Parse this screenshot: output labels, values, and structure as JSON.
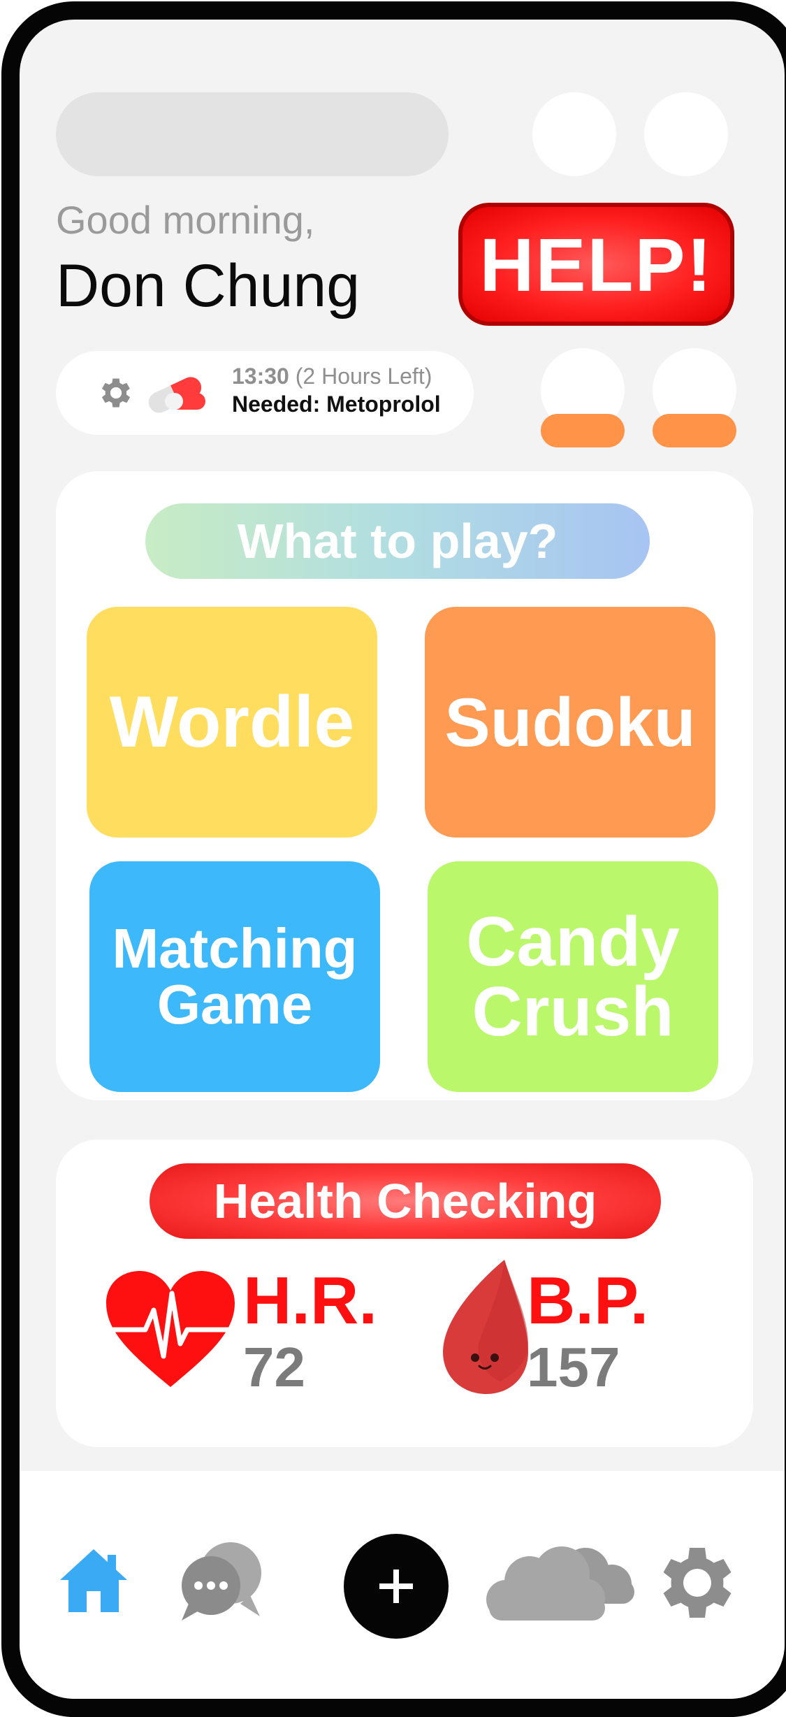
{
  "greeting": {
    "salutation": "Good morning,",
    "name": "Don Chung"
  },
  "help_button": {
    "label": "HELP!"
  },
  "medication": {
    "time": "13:30",
    "time_left": "(2 Hours Left)",
    "needed_label": "Needed:",
    "medicine": "Metoprolol",
    "icons": [
      "gear-icon",
      "pill-icon"
    ]
  },
  "games": {
    "title": "What to play?",
    "tiles": [
      {
        "label_line1": "Wordle",
        "label_line2": "",
        "color": "#ffdd5e"
      },
      {
        "label_line1": "Sudoku",
        "label_line2": "",
        "color": "#ff9a52"
      },
      {
        "label_line1": "Matching",
        "label_line2": "Game",
        "color": "#3db8fa"
      },
      {
        "label_line1": "Candy",
        "label_line2": "Crush",
        "color": "#bbf76a"
      }
    ]
  },
  "health": {
    "title": "Health Checking",
    "metrics": [
      {
        "label": "H.R.",
        "value": "72",
        "icon": "heart-icon"
      },
      {
        "label": "B.P.",
        "value": "157",
        "icon": "blood-drop-icon"
      }
    ]
  },
  "nav": {
    "items": [
      "home-icon",
      "chat-icon",
      "add-icon",
      "cloud-icon",
      "settings-icon"
    ],
    "active": "home-icon",
    "accent": "#3aaaf4"
  },
  "colors": {
    "help_red": "#ff1f1f",
    "orange": "#ff9448",
    "metric_red": "#ff1010"
  }
}
